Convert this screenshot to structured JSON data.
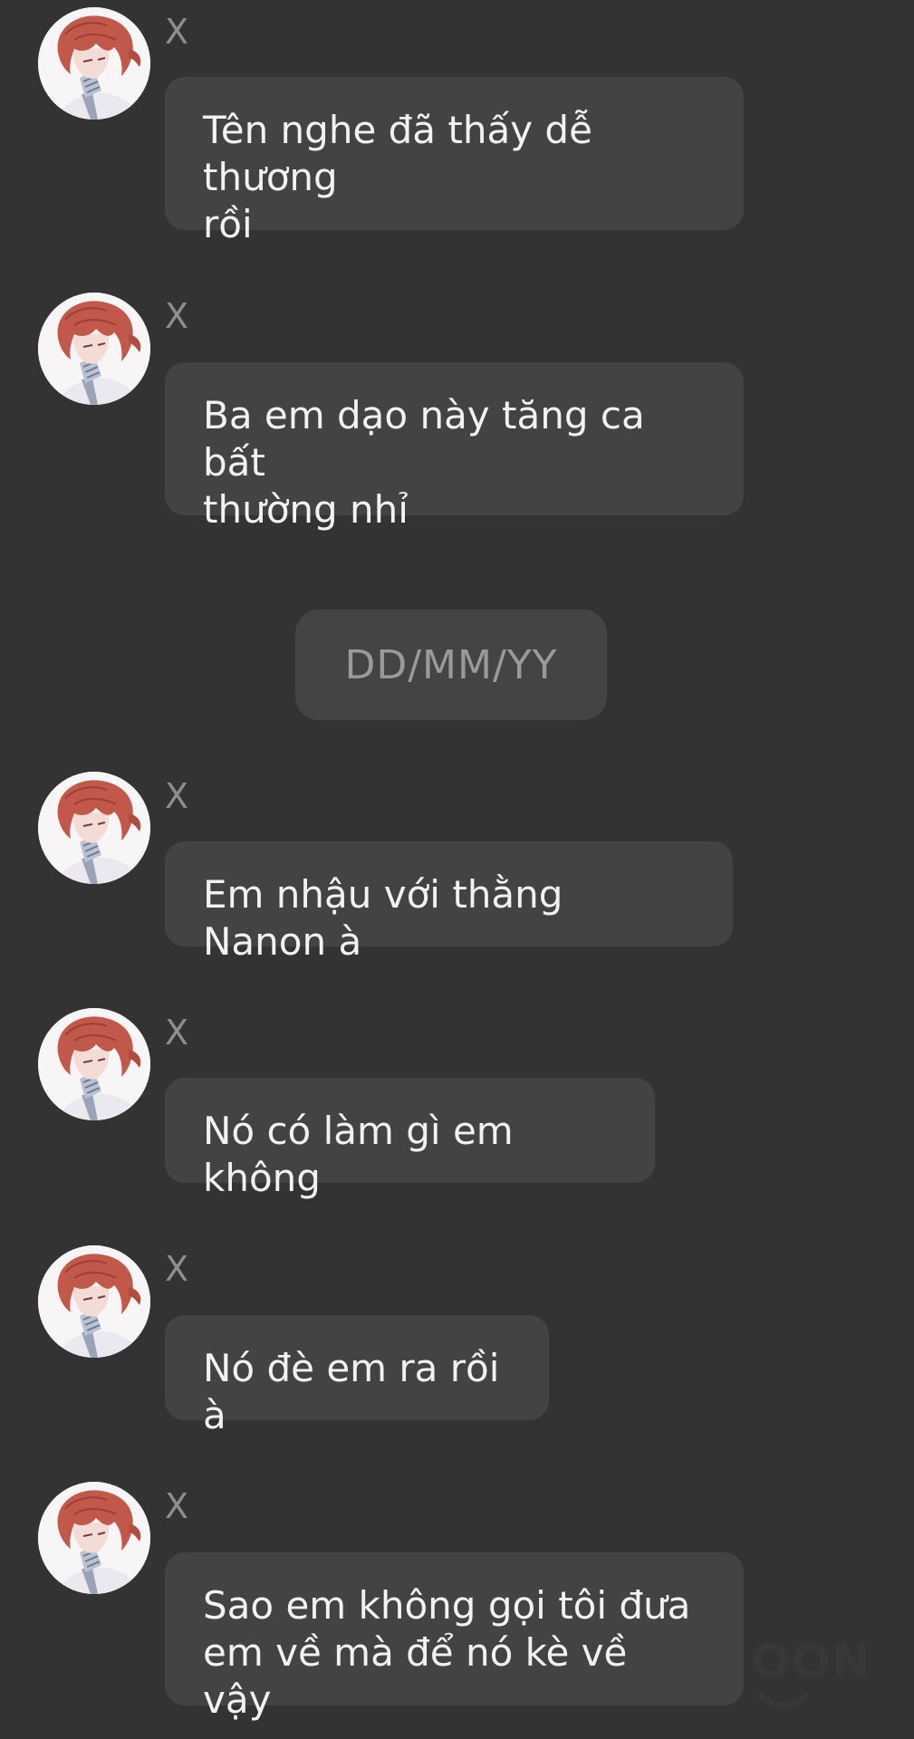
{
  "messages": [
    {
      "sender": "X",
      "avatar_icon": "character-avatar-icon",
      "text": "Tên nghe đã thấy dễ thương\nrồi"
    },
    {
      "sender": "X",
      "avatar_icon": "character-avatar-icon",
      "text": "Ba em dạo này tăng ca bất\nthường nhỉ"
    },
    {
      "sender": "X",
      "avatar_icon": "character-avatar-icon",
      "text": "Em nhậu với thằng Nanon à"
    },
    {
      "sender": "X",
      "avatar_icon": "character-avatar-icon",
      "text": "Nó có làm gì em không"
    },
    {
      "sender": "X",
      "avatar_icon": "character-avatar-icon",
      "text": "Nó đè em ra rồi à"
    },
    {
      "sender": "X",
      "avatar_icon": "character-avatar-icon",
      "text": "Sao em không gọi tôi đưa\nem về mà để nó kè về vậy"
    }
  ],
  "date_separator": "DD/MM/YY",
  "watermark": {
    "icon": "site-watermark-logo",
    "text": "OON"
  },
  "colors": {
    "background": "#333333",
    "bubble": "#434343",
    "bubble_text": "#f2f2f2",
    "sender_text": "#8e8e8e",
    "avatar_hair": "#c2584a"
  }
}
